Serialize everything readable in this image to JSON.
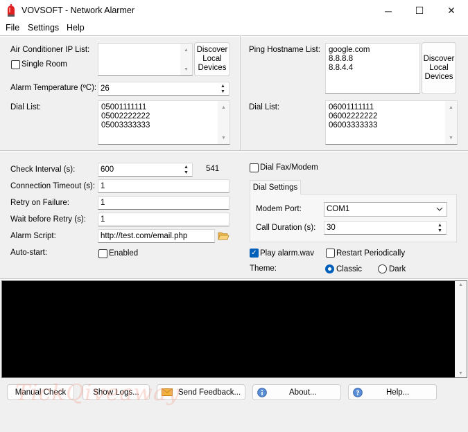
{
  "window": {
    "title": "VOVSOFT - Network Alarmer",
    "minimize": "─",
    "maximize": "☐",
    "close": "✕"
  },
  "menu": [
    "File",
    "Settings",
    "Help"
  ],
  "left": {
    "ac_label": "Air Conditioner IP List:",
    "single_room": "Single Room",
    "discover": "Discover Local Devices",
    "alarm_temp_label": "Alarm Temperature (ºC):",
    "alarm_temp_value": "26",
    "dial_list_label": "Dial List:",
    "dial_list": [
      "05001111111",
      "05002222222",
      "05003333333"
    ]
  },
  "right": {
    "ping_label": "Ping Hostname List:",
    "ping_list": [
      "google.com",
      "8.8.8.8",
      "8.8.4.4"
    ],
    "discover": "Discover Local Devices",
    "dial_list_label": "Dial List:",
    "dial_list": [
      "06001111111",
      "06002222222",
      "06003333333"
    ]
  },
  "settings": {
    "check_interval_label": "Check Interval (s):",
    "check_interval_value": "600",
    "countdown": "541",
    "conn_timeout_label": "Connection Timeout (s):",
    "conn_timeout_value": "1",
    "retry_label": "Retry on Failure:",
    "retry_value": "1",
    "wait_label": "Wait before Retry (s):",
    "wait_value": "1",
    "script_label": "Alarm Script:",
    "script_value": "http://test.com/email.php",
    "autostart_label": "Auto-start:",
    "enabled": "Enabled"
  },
  "dial": {
    "fax_modem": "Dial Fax/Modem",
    "tab": "Dial Settings",
    "modem_port_label": "Modem Port:",
    "modem_port_value": "COM1",
    "call_duration_label": "Call Duration (s):",
    "call_duration_value": "30",
    "play_alarm": "Play alarm.wav",
    "restart": "Restart Periodically",
    "theme_label": "Theme:",
    "classic": "Classic",
    "dark": "Dark"
  },
  "buttons": {
    "manual_check": "Manual Check",
    "show_logs": "Show Logs...",
    "send_feedback": "Send Feedback...",
    "about": "About...",
    "help": "Help..."
  },
  "watermark": "TickQiveaway",
  "colors": {
    "accent": "#005fb8",
    "console": "#000000",
    "app_icon": "#e02020"
  }
}
